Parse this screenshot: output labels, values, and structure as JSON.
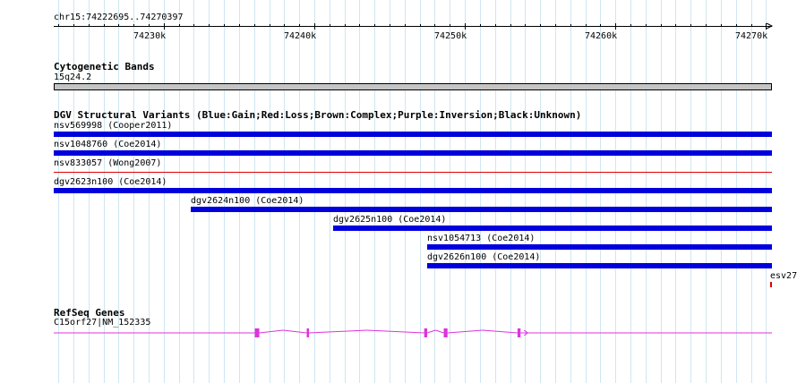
{
  "view": {
    "chrom": "chr15",
    "start": 74222695,
    "end": 74270397
  },
  "ruler": {
    "position_label": "chr15:74222695..74270397",
    "major_ticks": [
      {
        "pos": 74230000,
        "label": "74230k"
      },
      {
        "pos": 74240000,
        "label": "74240k"
      },
      {
        "pos": 74250000,
        "label": "74250k"
      },
      {
        "pos": 74260000,
        "label": "74260k"
      },
      {
        "pos": 74270000,
        "label": "74270k"
      }
    ]
  },
  "tracks": {
    "cytoband": {
      "title": "Cytogenetic Bands",
      "band_label": "15q24.2",
      "band_color": "#c4c4c4"
    },
    "dgv": {
      "title": "DGV Structural Variants (Blue:Gain;Red:Loss;Brown:Complex;Purple:Inversion;Black:Unknown)",
      "colors": {
        "gain": "#0000dd",
        "loss": "#dd0000"
      },
      "features": [
        {
          "label": "nsv569998 (Cooper2011)",
          "start": 74222695,
          "end": 74270397,
          "type": "gain"
        },
        {
          "label": "nsv1048760 (Coe2014)",
          "start": 74222695,
          "end": 74270397,
          "type": "gain"
        },
        {
          "label": "nsv833057 (Wong2007)",
          "start": 74222695,
          "end": 74270397,
          "type": "loss"
        },
        {
          "label": "dgv2623n100 (Coe2014)",
          "start": 74222695,
          "end": 74270397,
          "type": "gain"
        },
        {
          "label": "dgv2624n100 (Coe2014)",
          "start": 74231800,
          "end": 74270397,
          "type": "gain"
        },
        {
          "label": "dgv2625n100 (Coe2014)",
          "start": 74241250,
          "end": 74270397,
          "type": "gain"
        },
        {
          "label": "nsv1054713 (Coe2014)",
          "start": 74247500,
          "end": 74270397,
          "type": "gain"
        },
        {
          "label": "dgv2626n100 (Coe2014)",
          "start": 74247500,
          "end": 74270397,
          "type": "gain"
        },
        {
          "label": "esv27",
          "start": 74270300,
          "end": 74270397,
          "type": "loss"
        }
      ]
    },
    "refseq": {
      "title": "RefSeq Genes",
      "gene_label": "C15orf27|NM_152335",
      "color": "#dd33dd",
      "exons": [
        {
          "start": 74236050,
          "end": 74236350
        },
        {
          "start": 74239500,
          "end": 74239650
        },
        {
          "start": 74247300,
          "end": 74247500
        },
        {
          "start": 74248600,
          "end": 74248850
        },
        {
          "start": 74253500,
          "end": 74253700
        }
      ]
    }
  }
}
